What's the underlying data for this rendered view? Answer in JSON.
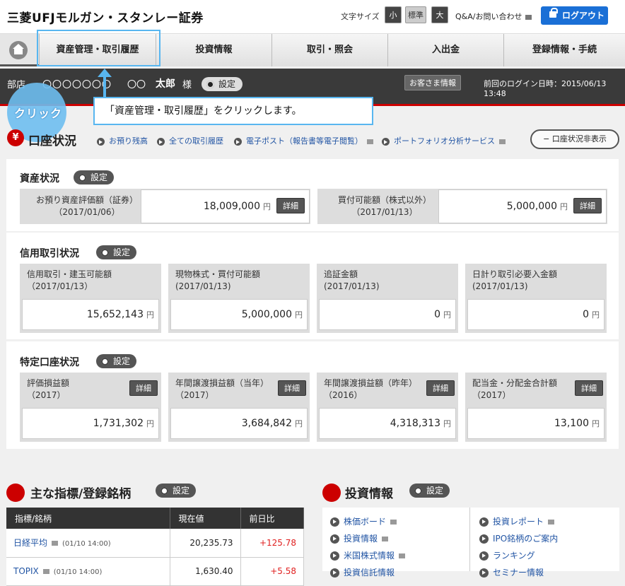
{
  "header": {
    "logo": "三菱UFJモルガン・スタンレー証券",
    "font_size_label": "文字サイズ",
    "font_small": "小",
    "font_standard": "標準",
    "font_large": "大",
    "qa": "Q&A/お問い合わせ",
    "logout": "ログアウト"
  },
  "nav": {
    "items": [
      "資産管理・取引履歴",
      "投資情報",
      "取引・照会",
      "入出金",
      "登録情報・手続"
    ]
  },
  "account": {
    "branch": "部店",
    "masked_id": "〇〇〇〇〇〇〇",
    "masked_surname": "〇〇",
    "given_name": "太郎",
    "honorific": "様",
    "settings": "設定",
    "customer_info": "お客さま情報",
    "last_login": "前回のログイン日時：2015/06/13 13:48"
  },
  "tutorial": {
    "click_label": "クリック",
    "callout": "「資産管理・取引履歴」をクリックします。"
  },
  "asset_section": {
    "icon_glyph": "¥",
    "title": "口座状況",
    "links": [
      "お預り残高",
      "全ての取引履歴",
      "電子ポスト（報告書等電子閲覧）",
      "ポートフォリオ分析サービス"
    ],
    "hide_button": "口座状況非表示"
  },
  "asset_status": {
    "title": "資産状況",
    "settings": "設定",
    "boxes": [
      {
        "label1": "お預り資産評価額（証券）",
        "label2": "（2017/01/06）",
        "value": "18,009,000",
        "unit": "円",
        "detail": "詳細"
      },
      {
        "label1": "買付可能額（株式以外）",
        "label2": "（2017/01/13）",
        "value": "5,000,000",
        "unit": "円",
        "detail": "詳細"
      }
    ]
  },
  "margin_status": {
    "title": "信用取引状況",
    "settings": "設定",
    "boxes": [
      {
        "label1": "信用取引・建玉可能額",
        "label2": "（2017/01/13）",
        "value": "15,652,143",
        "unit": "円"
      },
      {
        "label1": "現物株式・買付可能額",
        "label2": "(2017/01/13)",
        "value": "5,000,000",
        "unit": "円"
      },
      {
        "label1": "追証金額",
        "label2": "(2017/01/13)",
        "value": "0",
        "unit": "円"
      },
      {
        "label1": "日計り取引必要入金額",
        "label2": "(2017/01/13)",
        "value": "0",
        "unit": "円"
      }
    ]
  },
  "special_status": {
    "title": "特定口座状況",
    "settings": "設定",
    "boxes": [
      {
        "label1": "評価損益額",
        "label2": "（2017）",
        "value": "1,731,302",
        "unit": "円",
        "detail": "詳細"
      },
      {
        "label1": "年間譲渡損益額（当年）",
        "label2": "（2017）",
        "value": "3,684,842",
        "unit": "円",
        "detail": "詳細"
      },
      {
        "label1": "年間譲渡損益額（昨年）",
        "label2": "（2016）",
        "value": "4,318,313",
        "unit": "円",
        "detail": "詳細"
      },
      {
        "label1": "配当金・分配金合計額",
        "label2": "（2017）",
        "value": "13,100",
        "unit": "円",
        "detail": "詳細"
      }
    ]
  },
  "indices": {
    "title": "主な指標/登録銘柄",
    "settings": "設定",
    "columns": [
      "指標/銘柄",
      "現在値",
      "前日比"
    ],
    "rows": [
      {
        "name": "日経平均",
        "time": "(01/10 14:00)",
        "price": "20,235.73",
        "change": "+125.78"
      },
      {
        "name": "TOPIX",
        "time": "(01/10 14:00)",
        "price": "1,630.40",
        "change": "+5.58"
      }
    ]
  },
  "investment": {
    "title": "投資情報",
    "settings": "設定",
    "left_links": [
      "株価ボード",
      "投資情報",
      "米国株式情報",
      "投資信託情報"
    ],
    "right_links": [
      "投資レポート",
      "IPO銘柄のご案内",
      "ランキング",
      "セミナー情報"
    ]
  },
  "colors": {
    "accent": "#c00000",
    "highlight": "#58b6f0",
    "logout": "#1a6fd6",
    "positive": "#e02020"
  }
}
